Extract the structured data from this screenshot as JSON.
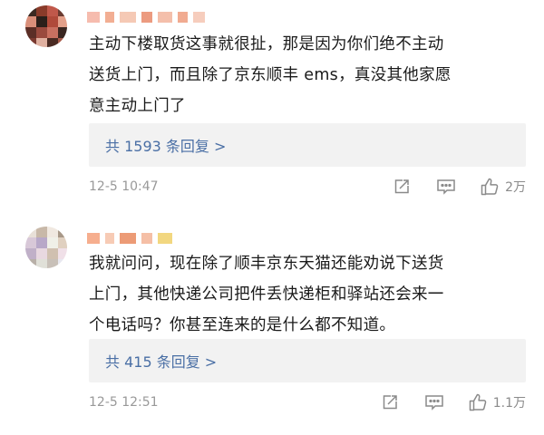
{
  "comments": [
    {
      "username": "",
      "username_colors": [
        "#f5b0a0",
        "#f0a080",
        "#f3c0a8",
        "#e98a6a",
        "#f2b49c",
        "#ee9c7e",
        "#f5c4b2"
      ],
      "avatar_colors": [
        "#3b2a22",
        "#8a3b2a",
        "#c0584a",
        "#6a3a30",
        "#d98f7a",
        "#2a1f1a",
        "#b04a3a",
        "#e3a08a",
        "#5b2e26",
        "#9a4a3e",
        "#c97060",
        "#3a2620",
        "#7a3a30",
        "#e0b0a0",
        "#4a2a22",
        "#a85a4a"
      ],
      "lines": [
        "主动下楼取货这事就很扯，那是因为你们绝不主动",
        "送货上门，而且除了京东顺丰 ems，真没其他家愿",
        "意主动上门了"
      ],
      "replies_label": "共 1593 条回复 >",
      "time": "12-5 10:47",
      "like_count": "2万"
    },
    {
      "username": "",
      "username_colors": [
        "#f4a07a",
        "#f6c2a8",
        "#e98a5e",
        "#f3b496",
        "#f0d06a"
      ],
      "avatar_colors": [
        "#e8e0d8",
        "#c8b8a8",
        "#f0e8e0",
        "#a89888",
        "#d8c8d8",
        "#b8a8c8",
        "#f0f0e8",
        "#e0d0c0",
        "#c0b0c8",
        "#e8d8e0",
        "#d0c0b0",
        "#f0e0e8",
        "#b8b0a8",
        "#e0e0d8",
        "#c8c0b8",
        "#e8e8f0"
      ],
      "lines": [
        "我就问问，现在除了顺丰京东天猫还能劝说下送货",
        "上门，其他快递公司把件丢快递柜和驿站还会来一",
        "个电话吗？你甚至连来的是什么都不知道。"
      ],
      "replies_label": "共 415 条回复 >",
      "time": "12-5 12:51",
      "like_count": "1.1万"
    }
  ]
}
